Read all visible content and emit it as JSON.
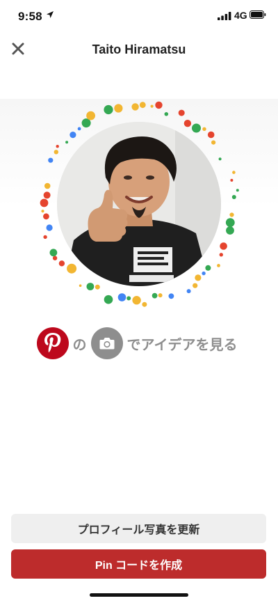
{
  "status_bar": {
    "time": "9:58",
    "network": "4G"
  },
  "header": {
    "title": "Taito Hiramatsu"
  },
  "caption": {
    "connector": "の",
    "suffix": "でアイデアを見る"
  },
  "buttons": {
    "update_photo": "プロフィール写真を更新",
    "create_pin_code": "Pin コードを作成"
  },
  "colors": {
    "brand_red": "#bd081c",
    "button_red": "#bd2c2c",
    "dot_red": "#e5442e",
    "dot_yellow": "#f2b632",
    "dot_green": "#34a853",
    "dot_blue": "#4285f4"
  }
}
